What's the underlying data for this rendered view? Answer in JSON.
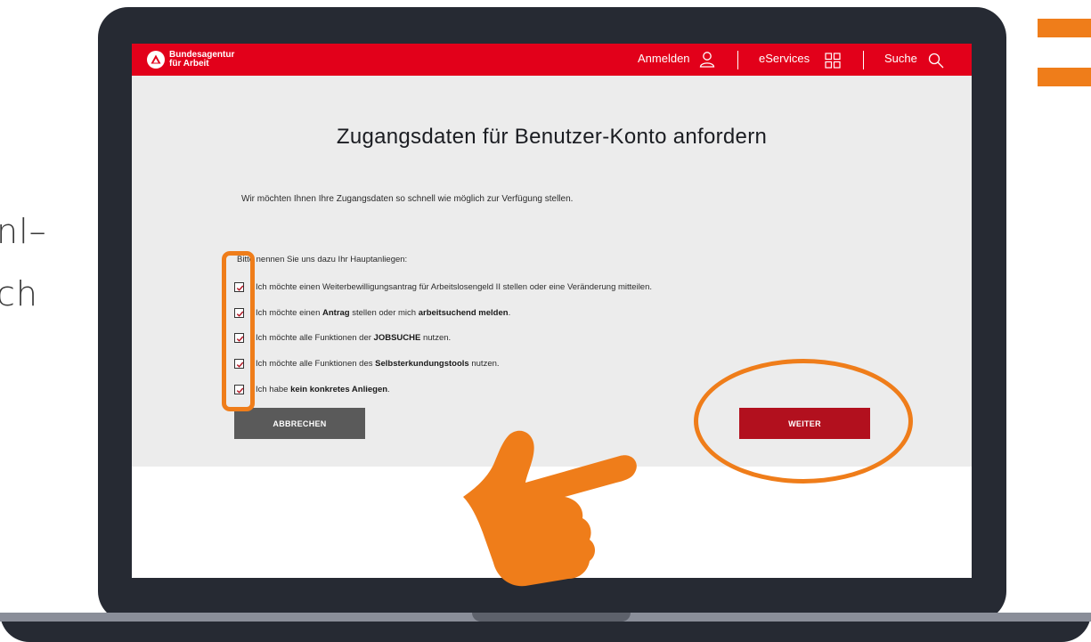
{
  "background_text": {
    "line1": "nl–",
    "line2": "ch"
  },
  "site": {
    "logo_line1": "Bundesagentur",
    "logo_line2": "für Arbeit",
    "nav": {
      "login": "Anmelden",
      "eservices": "eServices",
      "search": "Suche"
    }
  },
  "page": {
    "title": "Zugangsdaten für Benutzer-Konto anfordern",
    "intro": "Wir möchten Ihnen Ihre Zugangsdaten so schnell wie möglich zur Verfügung stellen.",
    "prompt": "Bitte nennen Sie uns dazu Ihr Hauptanliegen:",
    "options": [
      {
        "pre": "Ich möchte einen Weiterbewilligungsantrag für Arbeitslosengeld II stellen oder eine Veränderung mitteilen.",
        "checked": true
      },
      {
        "pre": "Ich möchte einen ",
        "bold1": "Antrag",
        "mid": " stellen oder mich ",
        "bold2": "arbeitsuchend melden",
        "post": ".",
        "checked": true
      },
      {
        "pre": "Ich möchte alle Funktionen der ",
        "bold1": "JOBSUCHE",
        "post": " nutzen.",
        "checked": true
      },
      {
        "pre": "Ich möchte alle Funktionen des ",
        "bold1": "Selbsterkundungstools",
        "post": " nutzen.",
        "checked": true
      },
      {
        "pre": "Ich habe ",
        "bold1": "kein konkretes Anliegen",
        "post": ".",
        "checked": true
      }
    ],
    "cancel_label": "ABBRECHEN",
    "next_label": "WEITER"
  },
  "colors": {
    "brand_red": "#e2001a",
    "button_red": "#b2101e",
    "highlight_orange": "#ef7d1a"
  },
  "icons": [
    "user-icon",
    "grid-icon",
    "search-icon",
    "checkbox-checked-icon",
    "pointing-hand-icon"
  ]
}
